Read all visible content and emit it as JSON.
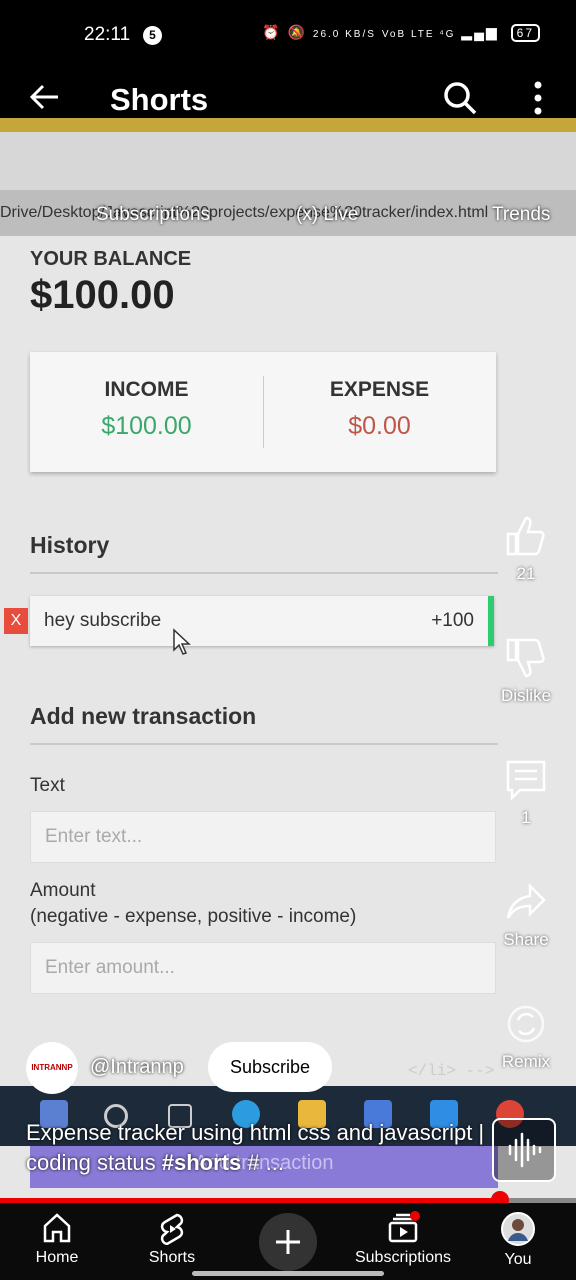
{
  "status_bar": {
    "time": "22:11",
    "notif_count": "5",
    "net_speed": "26.0 KB/S",
    "network": "VoB LTE ⁴G",
    "battery": "67"
  },
  "top_bar": {
    "title": "Shorts"
  },
  "video": {
    "url_fragment": "Drive/Desktop/Javascript%20projects/expense%20tracker/index.html",
    "overlay_chips": [
      "Subscriptions",
      "(x) Live",
      "Trends"
    ],
    "app": {
      "balance_label": "YOUR BALANCE",
      "balance": "$100.00",
      "income_label": "INCOME",
      "income": "$100.00",
      "expense_label": "EXPENSE",
      "expense": "$0.00",
      "history_title": "History",
      "history_items": [
        {
          "text": "hey subscribe",
          "amount": "+100",
          "delete_label": "X"
        }
      ],
      "add_title": "Add new transaction",
      "text_label": "Text",
      "text_placeholder": "Enter text...",
      "amount_label": "Amount",
      "amount_hint": "(negative - expense, positive - income)",
      "amount_placeholder": "Enter amount...",
      "submit_label": "Add transaction"
    },
    "code_fragment": "</li> -->"
  },
  "actions": {
    "like_count": "21",
    "dislike_label": "Dislike",
    "comment_count": "1",
    "share_label": "Share",
    "remix_label": "Remix"
  },
  "channel": {
    "logo_text": "INTRANNP",
    "handle": "@Intrannp",
    "subscribe_label": "Subscribe"
  },
  "caption": {
    "text": "Expense tracker using html css and javascript | coding status ",
    "hashtag": "#shorts",
    "more": " # ..."
  },
  "progress": {
    "fraction": 0.868
  },
  "bottom_nav": {
    "items": [
      {
        "label": "Home"
      },
      {
        "label": "Shorts"
      },
      {
        "label": "Subscriptions"
      },
      {
        "label": "You"
      }
    ]
  },
  "colors": {
    "income_green": "#2ecc71",
    "expense_red": "#c0392b",
    "accent_red": "#e00000",
    "submit_purple": "#8a7ad8"
  }
}
